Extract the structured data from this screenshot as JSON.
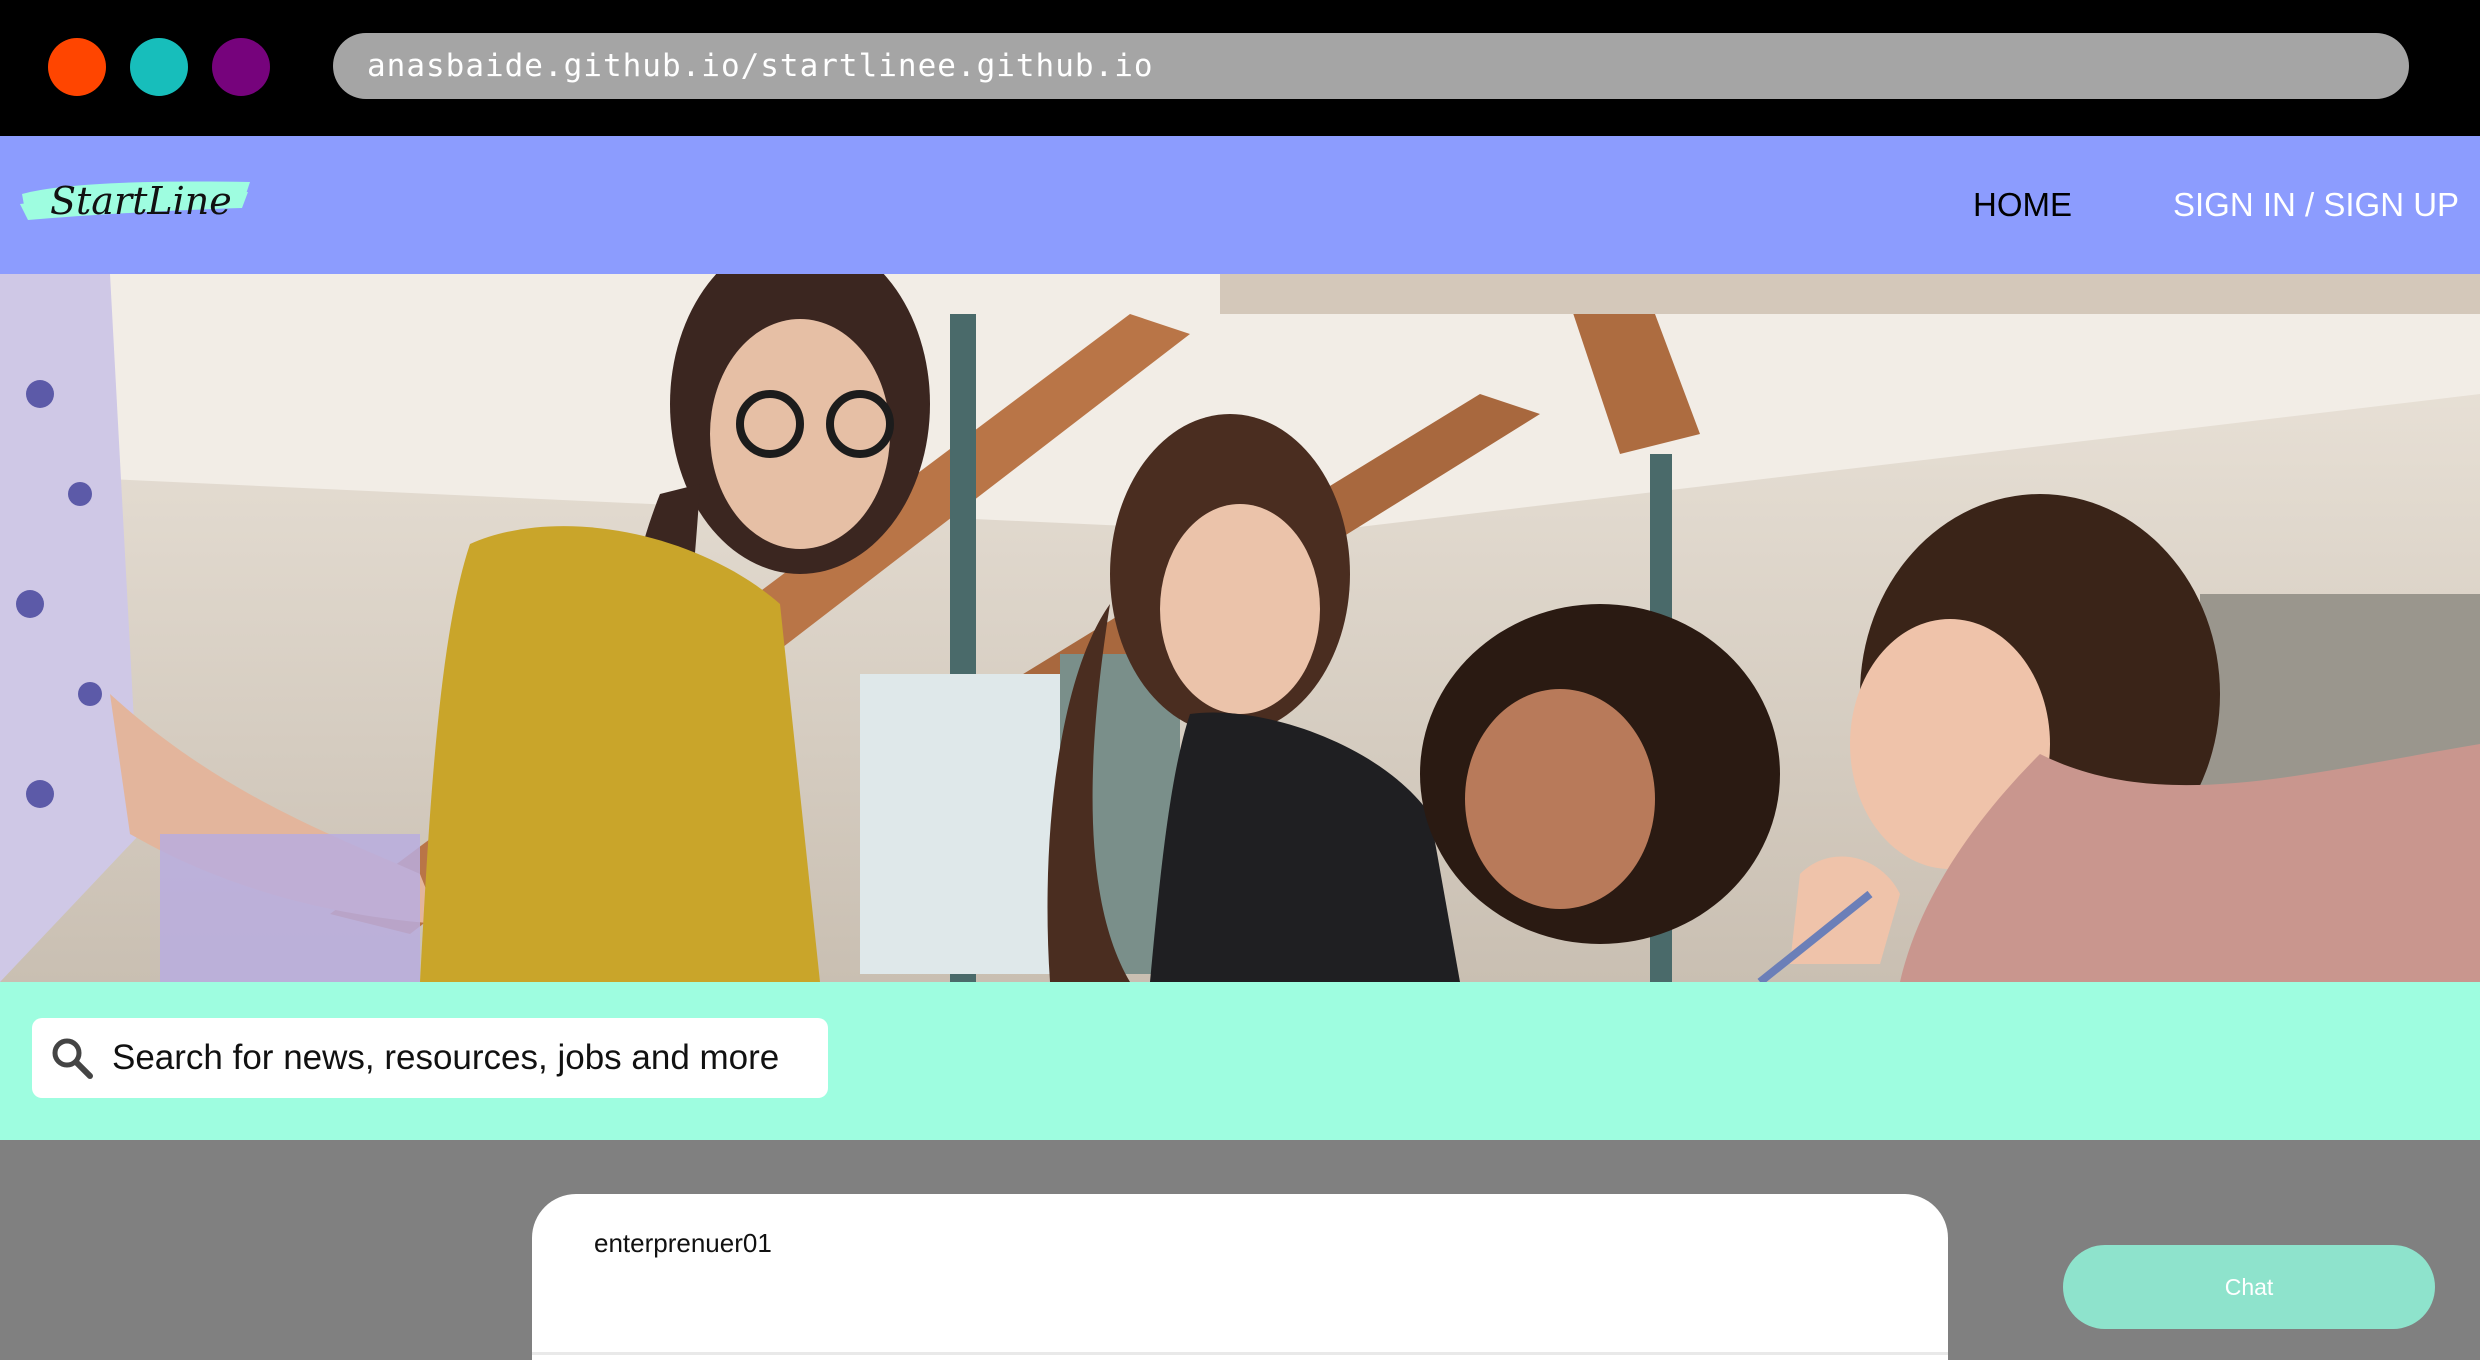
{
  "browser": {
    "url": "anasbaide.github.io/startlinee.github.io",
    "window_controls": [
      {
        "icon": "close-dot",
        "color": "#ff4500"
      },
      {
        "icon": "minimize-dot",
        "color": "#17bebb"
      },
      {
        "icon": "zoom-dot",
        "color": "#76037c"
      }
    ]
  },
  "navbar": {
    "background": "#8c9cfe",
    "logo_text": "StartLine",
    "links": [
      {
        "label": "HOME"
      },
      {
        "label": "SIGN IN / SIGN UP"
      }
    ]
  },
  "hero": {
    "image": "photo-of-four-women-collaborating-around-a-table"
  },
  "search": {
    "icon": "search-icon",
    "placeholder": "Search for news, resources, jobs and more",
    "band_color": "#9efde0"
  },
  "post": {
    "username": "enterprenuer01"
  },
  "chat": {
    "label": "Chat",
    "color": "#8ee3cc"
  }
}
